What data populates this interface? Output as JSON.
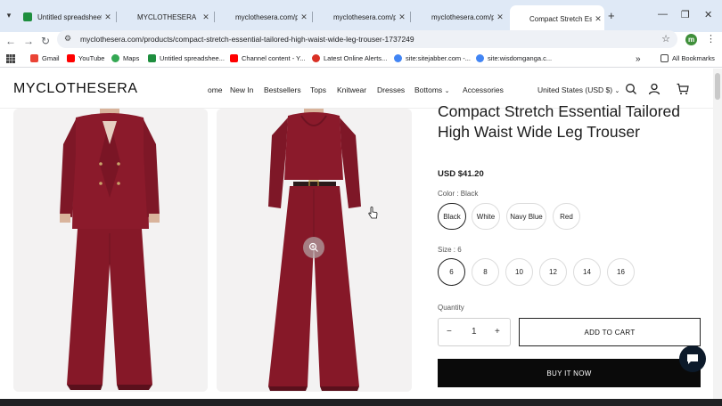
{
  "browser": {
    "tabs": [
      {
        "title": "Untitled spreadsheet",
        "favicon": "sheets-icon"
      },
      {
        "title": "MYCLOTHESERA",
        "favicon": "blank"
      },
      {
        "title": "myclothesera.com/p",
        "favicon": "blank"
      },
      {
        "title": "myclothesera.com/p",
        "favicon": "blank"
      },
      {
        "title": "myclothesera.com/p",
        "favicon": "blank"
      },
      {
        "title": "Compact Stretch Esse",
        "favicon": "blank",
        "active": true
      }
    ],
    "url": "myclothesera.com/products/compact-stretch-essential-tailored-high-waist-wide-leg-trouser-1737249",
    "profile_initial": "m",
    "bookmarks": [
      {
        "label": "Gmail",
        "icon": "gmail-icon"
      },
      {
        "label": "YouTube",
        "icon": "youtube-icon"
      },
      {
        "label": "Maps",
        "icon": "maps-icon"
      },
      {
        "label": "Untitled spreadshee...",
        "icon": "sheets-icon"
      },
      {
        "label": "Channel content - Y...",
        "icon": "youtube-icon"
      },
      {
        "label": "Latest Online Alerts...",
        "icon": "alert-icon"
      },
      {
        "label": "site:sitejabber.com -...",
        "icon": "google-icon"
      },
      {
        "label": "site:wisdomganga.c...",
        "icon": "google-icon"
      }
    ],
    "all_bookmarks": "All Bookmarks"
  },
  "site": {
    "logo": "MYCLOTHESERA",
    "nav": [
      "ome",
      "New In",
      "Bestsellers",
      "Tops",
      "Knitwear",
      "Dresses",
      "Bottoms",
      "Accessories"
    ],
    "currency": "United States (USD $)"
  },
  "product": {
    "title": "Compact Stretch Essential Tailored High Waist Wide Leg Trouser",
    "price": "USD $41.20",
    "color_label": "Color : Black",
    "colors": [
      "Black",
      "White",
      "Navy Blue",
      "Red"
    ],
    "selected_color": "Black",
    "size_label": "Size : 6",
    "sizes": [
      "6",
      "8",
      "10",
      "12",
      "14",
      "16"
    ],
    "selected_size": "6",
    "quantity_label": "Quantity",
    "quantity": "1",
    "add_to_cart": "ADD TO CART",
    "buy_now": "BUY IT NOW"
  },
  "colors": {
    "garment": "#8b1a2b",
    "garment_dark": "#6e1322",
    "accent": "#0a0a0a"
  }
}
